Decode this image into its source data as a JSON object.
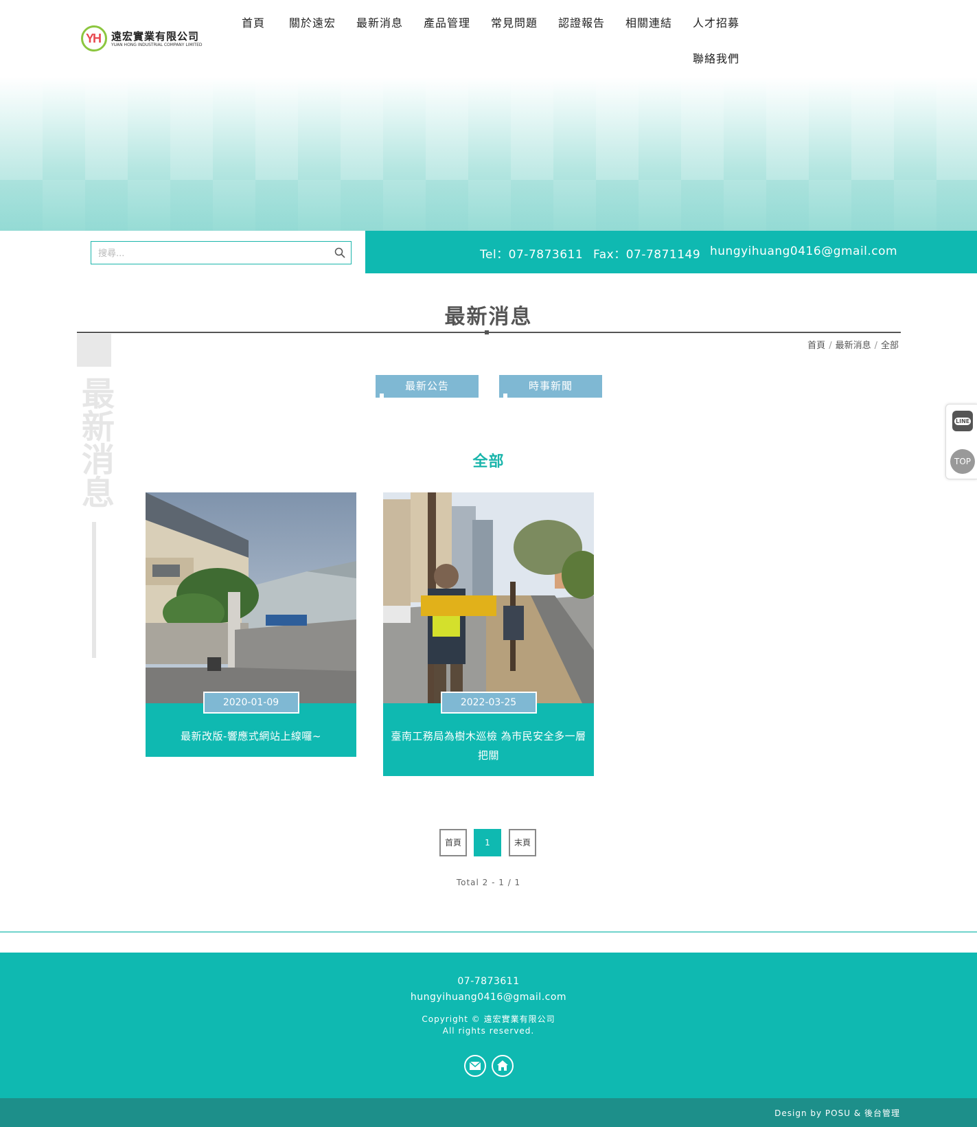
{
  "header": {
    "logo_mark": "YH",
    "logo_name": "遠宏實業有限公司",
    "logo_sub": "YUAN HONG INDUSTRIAL COMPANY LIMITED",
    "nav": [
      "首頁",
      "關於遠宏",
      "最新消息",
      "產品管理",
      "常見問題",
      "認證報告",
      "相關連結",
      "人才招募",
      "聯絡我們"
    ]
  },
  "search": {
    "placeholder": "搜尋..."
  },
  "contact": {
    "tel": "Tel：07-7873611",
    "fax": "Fax：07-7871149",
    "email": "hungyihuang0416@gmail.com"
  },
  "page_title": "最新消息",
  "side_label": "最新消息",
  "breadcrumb": [
    "首頁",
    "最新消息",
    "全部"
  ],
  "tabs": [
    "最新公告",
    "時事新聞"
  ],
  "category_title": "全部",
  "posts": [
    {
      "date": "2020-01-09",
      "title": "最新改版-響應式網站上線囉~"
    },
    {
      "date": "2022-03-25",
      "title": "臺南工務局為樹木巡檢 為市民安全多一層把關"
    }
  ],
  "pagination": {
    "first": "首頁",
    "current": "1",
    "last": "末頁",
    "total": "Total 2 - 1 / 1"
  },
  "footer": {
    "phone": "07-7873611",
    "email": "hungyihuang0416@gmail.com",
    "copyright": "Copyright © 遠宏實業有限公司",
    "rights": "All rights reserved.",
    "design": "Design by POSU & 後台管理"
  },
  "float": {
    "line": "LINE",
    "top": "TOP"
  },
  "colors": {
    "accent": "#0fb9b1",
    "tab": "#7fb8d3",
    "footer_bottom": "#1d8f8a"
  }
}
